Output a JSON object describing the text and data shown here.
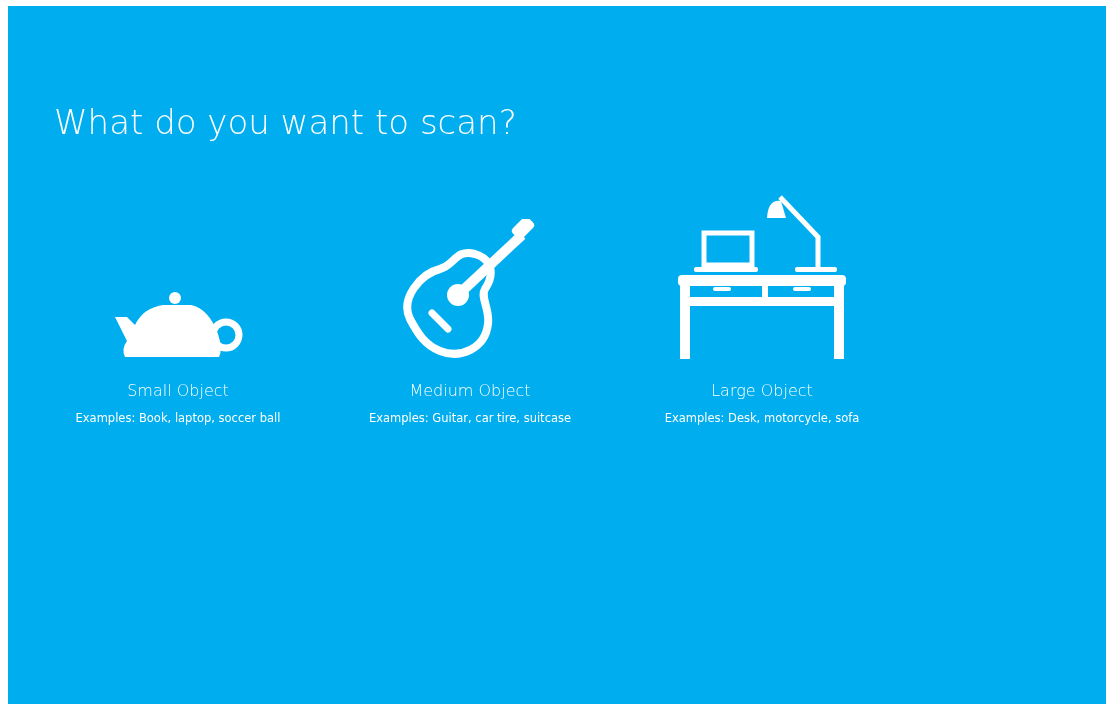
{
  "title": "What do you want to scan?",
  "options": [
    {
      "kind": "teapot",
      "label": "Small Object",
      "examples": "Examples: Book, laptop, soccer ball"
    },
    {
      "kind": "guitar",
      "label": "Medium Object",
      "examples": "Examples: Guitar, car tire, suitcase"
    },
    {
      "kind": "desk",
      "label": "Large Object",
      "examples": "Examples: Desk, motorcycle, sofa"
    }
  ]
}
